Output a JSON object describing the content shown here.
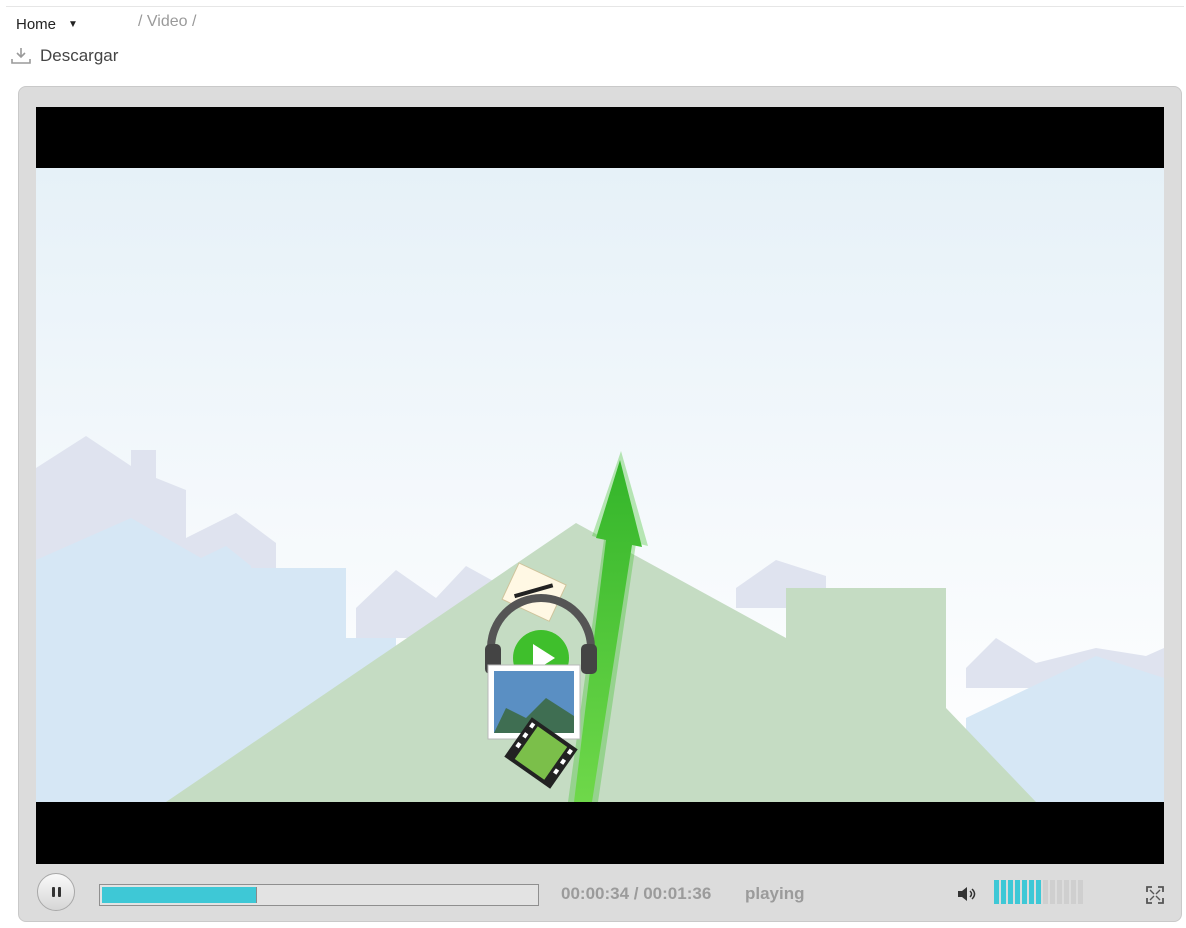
{
  "breadcrumb": {
    "home_label": "Home",
    "path_text": "/ Video /"
  },
  "download": {
    "label": "Descargar",
    "icon": "download-icon"
  },
  "player": {
    "current_time": "00:00:34",
    "duration": "00:01:36",
    "time_display": "00:00:34 / 00:01:36",
    "status": "playing",
    "progress_fraction": 0.354,
    "volume_level": 7,
    "volume_max": 13,
    "colors": {
      "accent": "#3ec8d6",
      "frame": "#dcdcdc",
      "arrow": "#4ac42a"
    },
    "icons": [
      "pause-icon",
      "volume-icon",
      "fullscreen-icon"
    ]
  }
}
